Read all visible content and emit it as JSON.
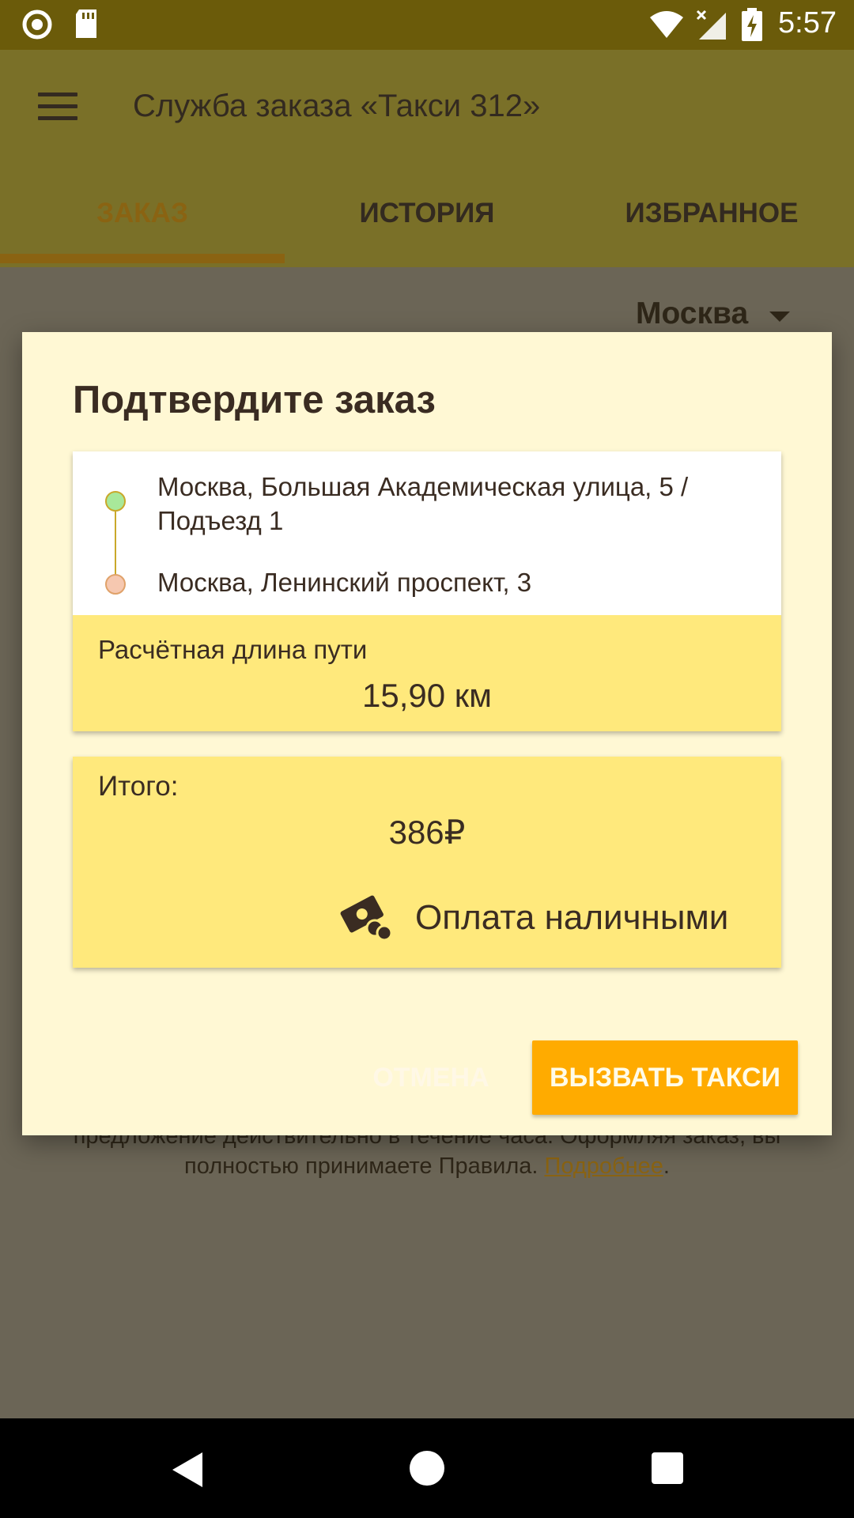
{
  "status_bar": {
    "time": "5:57",
    "icons": [
      "circle-notification-icon",
      "sd-card-icon",
      "wifi-icon",
      "signal-icon",
      "battery-charging-icon"
    ]
  },
  "app_bar": {
    "title": "Служба заказа «Такси 312»",
    "menu_icon": "hamburger-menu-icon",
    "tabs": [
      {
        "label": "ЗАКАЗ",
        "active": true
      },
      {
        "label": "ИСТОРИЯ",
        "active": false
      },
      {
        "label": "ИЗБРАННОЕ",
        "active": false
      }
    ]
  },
  "background": {
    "city": "Москва",
    "notice_line1": "предложение действительно в течение часа. Оформляя заказ, вы",
    "notice_line2": "полностью принимаете Правила.",
    "notice_link": "Подробнее",
    "notice_end": "."
  },
  "dialog": {
    "title": "Подтвердите заказ",
    "route": {
      "from": "Москва, Большая Академическая улица, 5 / Подъезд 1",
      "to": "Москва, Ленинский проспект, 3"
    },
    "distance_label": "Расчётная длина пути",
    "distance_value": "15,90 км",
    "total_label": "Итого:",
    "total_value": "386₽",
    "payment_icon": "cash-icon",
    "payment_label": "Оплата наличными",
    "cancel_label": "ОТМЕНА",
    "confirm_label": "ВЫЗВАТЬ ТАКСИ"
  },
  "colors": {
    "accent": "#ffab00",
    "card_yellow": "#ffe97c",
    "dialog_bg": "#fff8d4",
    "tab_active": "#8a6312"
  }
}
